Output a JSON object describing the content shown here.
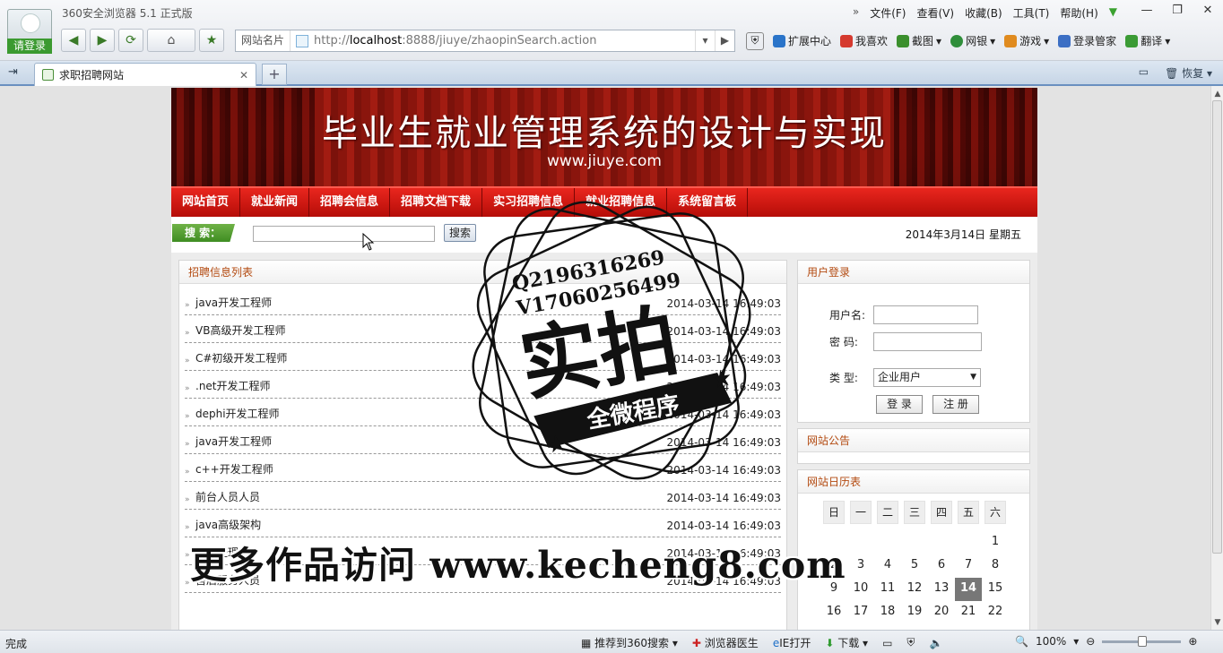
{
  "browser": {
    "title": "360安全浏览器 5.1 正式版",
    "login_badge": "请登录",
    "menu": [
      "文件(F)",
      "查看(V)",
      "收藏(B)",
      "工具(T)",
      "帮助(H)"
    ],
    "win_controls": [
      "—",
      "❐",
      "✕"
    ],
    "nav_buttons": [
      "◀",
      "▶",
      "⟳",
      "⌂",
      "★"
    ],
    "address": {
      "label": "网站名片",
      "url_prefix": "http://",
      "url_host": "localhost",
      "url_rest": ":8888/jiuye/zhaopinSearch.action"
    },
    "toolbar": [
      "扩展中心",
      "我喜欢",
      "截图",
      "网银",
      "游戏",
      "登录管家",
      "翻译"
    ],
    "toolbar_colors": [
      "#2a74c9",
      "#d53a2f",
      "#3b8f2d",
      "#2f8e3a",
      "#e08b1f",
      "#3c6fc4",
      "#3b9b35"
    ],
    "tab": {
      "title": "求职招聘网站",
      "close": "✕",
      "new": "+"
    },
    "restore_label": "恢复",
    "status": {
      "left": "完成",
      "items": [
        "推荐到360搜索",
        "浏览器医生",
        "IE打开",
        "下载"
      ],
      "zoom": "100%"
    }
  },
  "site": {
    "banner_title": "毕业生就业管理系统的设计与实现",
    "banner_sub": "www.jiuye.com",
    "nav": [
      "网站首页",
      "就业新闻",
      "招聘会信息",
      "招聘文档下载",
      "实习招聘信息",
      "就业招聘信息",
      "系统留言板"
    ],
    "search_label": "搜 索：",
    "search_button": "搜索",
    "date": "2014年3月14日  星期五",
    "list_title": "招聘信息列表",
    "jobs": [
      {
        "title": "java开发工程师",
        "time": "2014-03-14 16:49:03"
      },
      {
        "title": "VB高级开发工程师",
        "time": "2014-03-14 16:49:03"
      },
      {
        "title": "C#初级开发工程师",
        "time": "2014-03-14 16:49:03"
      },
      {
        "title": ".net开发工程师",
        "time": "2014-03-14 16:49:03"
      },
      {
        "title": "dephi开发工程师",
        "time": "2014-03-14 16:49:03"
      },
      {
        "title": "java开发工程师",
        "time": "2014-03-14 16:49:03"
      },
      {
        "title": "c++开发工程师",
        "time": "2014-03-14 16:49:03"
      },
      {
        "title": "前台人员人员",
        "time": "2014-03-14 16:49:03"
      },
      {
        "title": "java高级架构",
        "time": "2014-03-14 16:49:03"
      },
      {
        "title": "销售经理",
        "time": "2014-03-14 16:49:03"
      },
      {
        "title": "售后服务人员",
        "time": "2014-03-14 16:49:03"
      }
    ],
    "login": {
      "title": "用户登录",
      "user_label": "用户名:",
      "pass_label": "密  码:",
      "type_label": "类  型:",
      "type_value": "企业用户",
      "login_btn": "登 录",
      "register_btn": "注 册"
    },
    "notice_title": "网站公告",
    "calendar": {
      "title": "网站日历表",
      "weekdays": [
        "日",
        "一",
        "二",
        "三",
        "四",
        "五",
        "六"
      ],
      "weeks": [
        [
          "",
          "",
          "",
          "",
          "",
          "",
          "1"
        ],
        [
          "2",
          "3",
          "4",
          "5",
          "6",
          "7",
          "8"
        ],
        [
          "9",
          "10",
          "11",
          "12",
          "13",
          "14",
          "15"
        ],
        [
          "16",
          "17",
          "18",
          "19",
          "20",
          "21",
          "22"
        ]
      ],
      "today": "14"
    }
  },
  "overlay": {
    "stamp_lines": [
      "Q2196316269",
      "V17060256499"
    ],
    "stamp_big": "实拍",
    "stamp_ribbon": "全微程序",
    "watermark": "更多作品访问 www.kecheng8.com"
  }
}
